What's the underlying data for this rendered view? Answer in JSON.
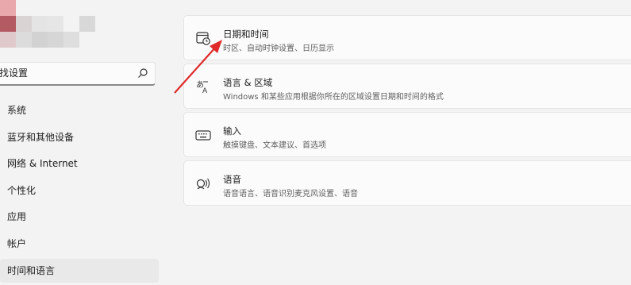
{
  "search": {
    "placeholder": "找设置"
  },
  "nav": {
    "items": [
      {
        "label": "系统"
      },
      {
        "label": "蓝牙和其他设备"
      },
      {
        "label": "网络 & Internet"
      },
      {
        "label": "个性化"
      },
      {
        "label": "应用"
      },
      {
        "label": "帐户"
      },
      {
        "label": "时间和语言"
      }
    ]
  },
  "cards": [
    {
      "title": "日期和时间",
      "desc": "时区、自动时钟设置、日历显示",
      "icon": "calendar-clock-icon"
    },
    {
      "title": "语言 & 区域",
      "desc": "Windows 和某些应用根据你所在的区域设置日期和时间的格式",
      "icon": "language-icon"
    },
    {
      "title": "输入",
      "desc": "触摸键盘、文本建议、首选项",
      "icon": "keyboard-icon"
    },
    {
      "title": "语音",
      "desc": "语音语言、语音识别麦克风设置、语音",
      "icon": "speech-icon"
    }
  ],
  "colors": {
    "annotation_arrow": "#e02a2a",
    "selected_bg": "#e9e9e9"
  }
}
